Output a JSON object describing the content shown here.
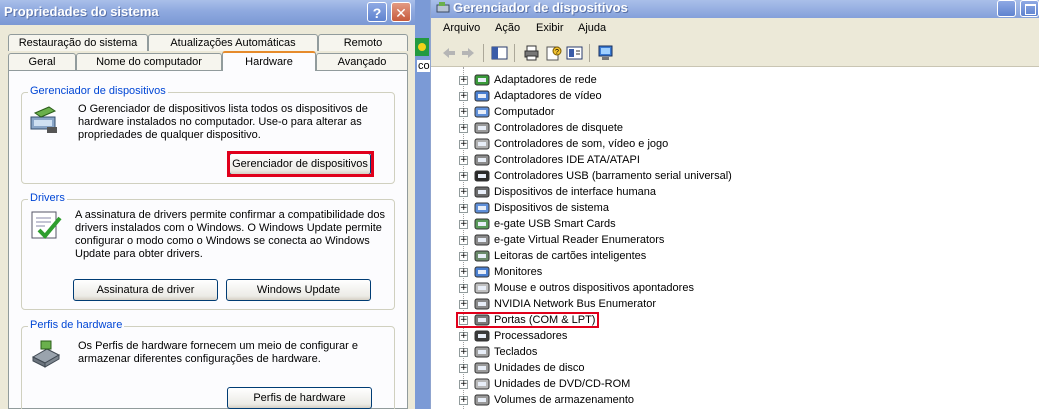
{
  "left_window": {
    "title": "Propriedades do sistema",
    "help_glyph": "?",
    "close_glyph": "✕",
    "tabs_back": [
      "Restauração do sistema",
      "Atualizações Automáticas",
      "Remoto"
    ],
    "tabs_front": [
      "Geral",
      "Nome do computador",
      "Hardware",
      "Avançado"
    ],
    "active_tab": "Hardware",
    "groups": {
      "device_manager": {
        "legend": "Gerenciador de dispositivos",
        "text": "O Gerenciador de dispositivos lista todos os dispositivos de hardware instalados no computador. Use-o para alterar as propriedades de qualquer dispositivo.",
        "button": "Gerenciador de dispositivos"
      },
      "drivers": {
        "legend": "Drivers",
        "text": "A assinatura de drivers permite confirmar a compatibilidade dos drivers instalados com o Windows. O Windows Update permite configurar o modo como o Windows se conecta ao Windows Update para obter drivers.",
        "button_signing": "Assinatura de driver",
        "button_update": "Windows Update"
      },
      "hardware_profiles": {
        "legend": "Perfis de hardware",
        "text": "Os Perfis de hardware fornecem um meio de configurar e armazenar diferentes configurações de hardware.",
        "button": "Perfis de hardware"
      }
    }
  },
  "background_fragment": {
    "text": "co"
  },
  "right_window": {
    "title": "Gerenciador de dispositivos",
    "menu": [
      "Arquivo",
      "Ação",
      "Exibir",
      "Ajuda"
    ],
    "toolbar_icons": [
      "back-arrow-icon",
      "forward-arrow-icon",
      "tree-view-icon",
      "print-icon",
      "properties-help-icon",
      "properties-icon",
      "computer-scan-icon"
    ],
    "expander_glyph": "+",
    "devices": [
      {
        "label": "Adaptadores de rede",
        "icon": "network-card-icon"
      },
      {
        "label": "Adaptadores de vídeo",
        "icon": "display-adapter-icon"
      },
      {
        "label": "Computador",
        "icon": "computer-icon"
      },
      {
        "label": "Controladores de disquete",
        "icon": "floppy-controller-icon"
      },
      {
        "label": "Controladores de som, vídeo e jogo",
        "icon": "sound-icon"
      },
      {
        "label": "Controladores IDE ATA/ATAPI",
        "icon": "ide-controller-icon"
      },
      {
        "label": "Controladores USB (barramento serial universal)",
        "icon": "usb-icon"
      },
      {
        "label": "Dispositivos de interface humana",
        "icon": "hid-icon"
      },
      {
        "label": "Dispositivos de sistema",
        "icon": "system-device-icon"
      },
      {
        "label": "e-gate USB Smart Cards",
        "icon": "smart-card-icon"
      },
      {
        "label": "e-gate Virtual Reader Enumerators",
        "icon": "reader-icon"
      },
      {
        "label": "Leitoras de cartões inteligentes",
        "icon": "smart-card-reader-icon"
      },
      {
        "label": "Monitores",
        "icon": "monitor-icon"
      },
      {
        "label": "Mouse e outros dispositivos apontadores",
        "icon": "mouse-icon"
      },
      {
        "label": "NVIDIA Network Bus Enumerator",
        "icon": "network-bus-icon"
      },
      {
        "label": "Portas (COM & LPT)",
        "icon": "port-icon"
      },
      {
        "label": "Processadores",
        "icon": "processor-icon"
      },
      {
        "label": "Teclados",
        "icon": "keyboard-icon"
      },
      {
        "label": "Unidades de disco",
        "icon": "disk-drive-icon"
      },
      {
        "label": "Unidades de DVD/CD-ROM",
        "icon": "cdrom-icon"
      },
      {
        "label": "Volumes de armazenamento",
        "icon": "storage-volume-icon"
      }
    ]
  },
  "highlight_color": "#e0001b"
}
